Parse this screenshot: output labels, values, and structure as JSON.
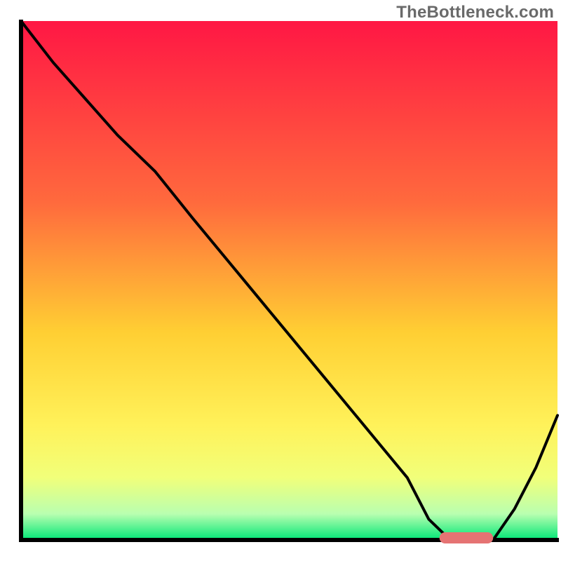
{
  "watermark": {
    "text": "TheBottleneck.com"
  },
  "colors": {
    "gradient_top": "#ff1744",
    "gradient_mid1": "#ff6a3d",
    "gradient_mid2": "#ffcf33",
    "gradient_mid3": "#fff25a",
    "gradient_mid4": "#f1ff7a",
    "gradient_bottom": "#00e676",
    "curve": "#000000",
    "axes": "#000000",
    "marker": "#e57373"
  },
  "chart_data": {
    "type": "line",
    "title": "",
    "xlabel": "",
    "ylabel": "",
    "xlim": [
      0,
      100
    ],
    "ylim": [
      0,
      100
    ],
    "series": [
      {
        "name": "bottleneck-curve",
        "x": [
          0,
          6,
          12,
          18,
          25,
          32,
          40,
          48,
          56,
          64,
          72,
          76,
          80,
          84,
          88,
          92,
          96,
          100
        ],
        "y": [
          100,
          92,
          85,
          78,
          71,
          62,
          52,
          42,
          32,
          22,
          12,
          4,
          0,
          0,
          0,
          6,
          14,
          24
        ]
      }
    ],
    "marker": {
      "name": "optimal-range",
      "x_start": 78,
      "x_end": 88,
      "y": 0
    },
    "gradient_stops_pct": [
      0,
      35,
      60,
      78,
      88,
      95,
      100
    ]
  }
}
